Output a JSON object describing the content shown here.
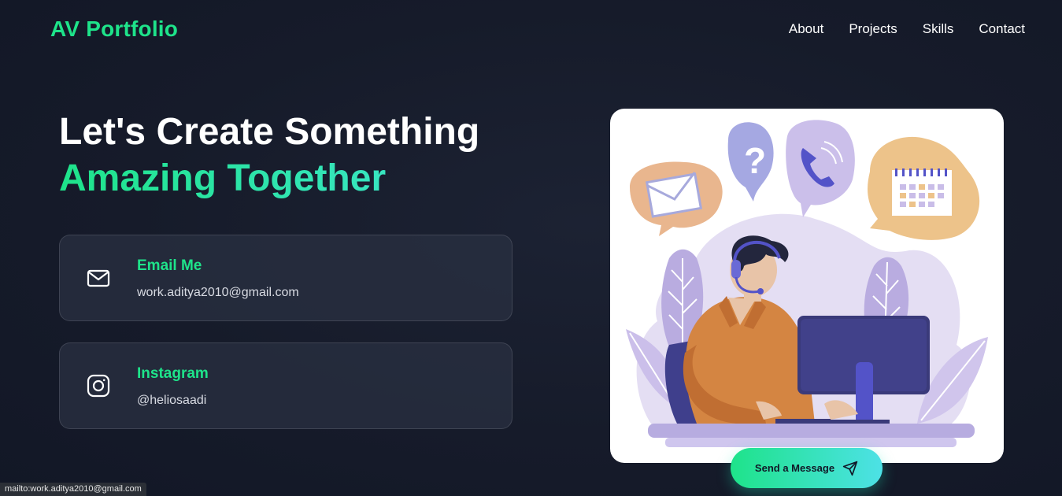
{
  "brand": "AV Portfolio",
  "nav": [
    "About",
    "Projects",
    "Skills",
    "Contact"
  ],
  "headline": {
    "line1": "Let's Create Something",
    "line2": "Amazing Together"
  },
  "contacts": {
    "email": {
      "title": "Email Me",
      "value": "work.aditya2010@gmail.com",
      "icon": "mail-icon"
    },
    "instagram": {
      "title": "Instagram",
      "value": "@heliosaadi",
      "icon": "instagram-icon"
    }
  },
  "send_button": {
    "label": "Send a Message",
    "icon": "send-icon"
  },
  "status_bar": "mailto:work.aditya2010@gmail.com",
  "colors": {
    "accent": "#1ee38a",
    "accent_secondary": "#4de1e6",
    "background": "#161b2a"
  }
}
